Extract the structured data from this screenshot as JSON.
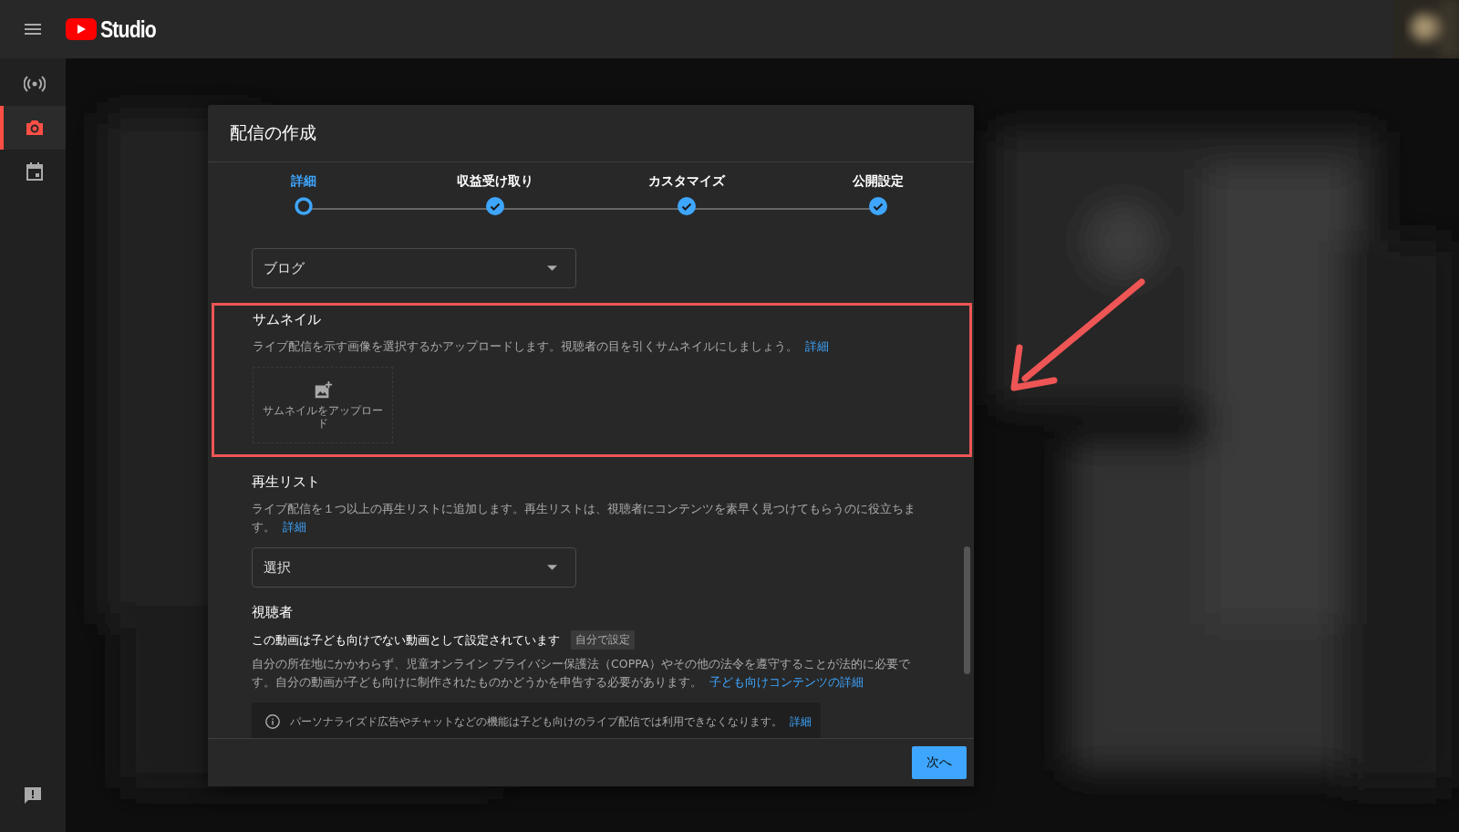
{
  "header": {
    "logo_text": "Studio"
  },
  "sidebar": {
    "items": [
      {
        "kind": "live",
        "selected": false
      },
      {
        "kind": "camera",
        "selected": true
      },
      {
        "kind": "calendar",
        "selected": false
      }
    ]
  },
  "dialog": {
    "title": "配信の作成",
    "steps": [
      {
        "label": "詳細",
        "selected": true,
        "completed": false
      },
      {
        "label": "収益受け取り",
        "selected": false,
        "completed": true
      },
      {
        "label": "カスタマイズ",
        "selected": false,
        "completed": true
      },
      {
        "label": "公開設定",
        "selected": false,
        "completed": true
      }
    ],
    "category": {
      "value": "ブログ"
    },
    "thumbnail": {
      "heading": "サムネイル",
      "description": "ライブ配信を示す画像を選択するかアップロードします。視聴者の目を引くサムネイルにしましょう。",
      "link": "詳細",
      "upload_label": "サムネイルをアップロード",
      "highlighted": true
    },
    "playlist": {
      "heading": "再生リスト",
      "description": "ライブ配信を１つ以上の再生リストに追加します。再生リストは、視聴者にコンテンツを素早く見つけてもらうのに役立ちます。",
      "link": "詳細",
      "value": "選択"
    },
    "audience": {
      "heading": "視聴者",
      "statement": "この動画は子ども向けでない動画として設定されています",
      "badge": "自分で設定",
      "description": "自分の所在地にかかわらず、児童オンライン プライバシー保護法（COPPA）やその他の法令を遵守することが法的に必要です。自分の動画が子ども向けに制作されたものかどうかを申告する必要があります。",
      "link": "子ども向けコンテンツの詳細",
      "notice": {
        "text": "パーソナライズド広告やチャットなどの機能は子ども向けのライブ配信では利用できなくなります。",
        "link": "詳細"
      }
    },
    "next_button": "次へ"
  }
}
